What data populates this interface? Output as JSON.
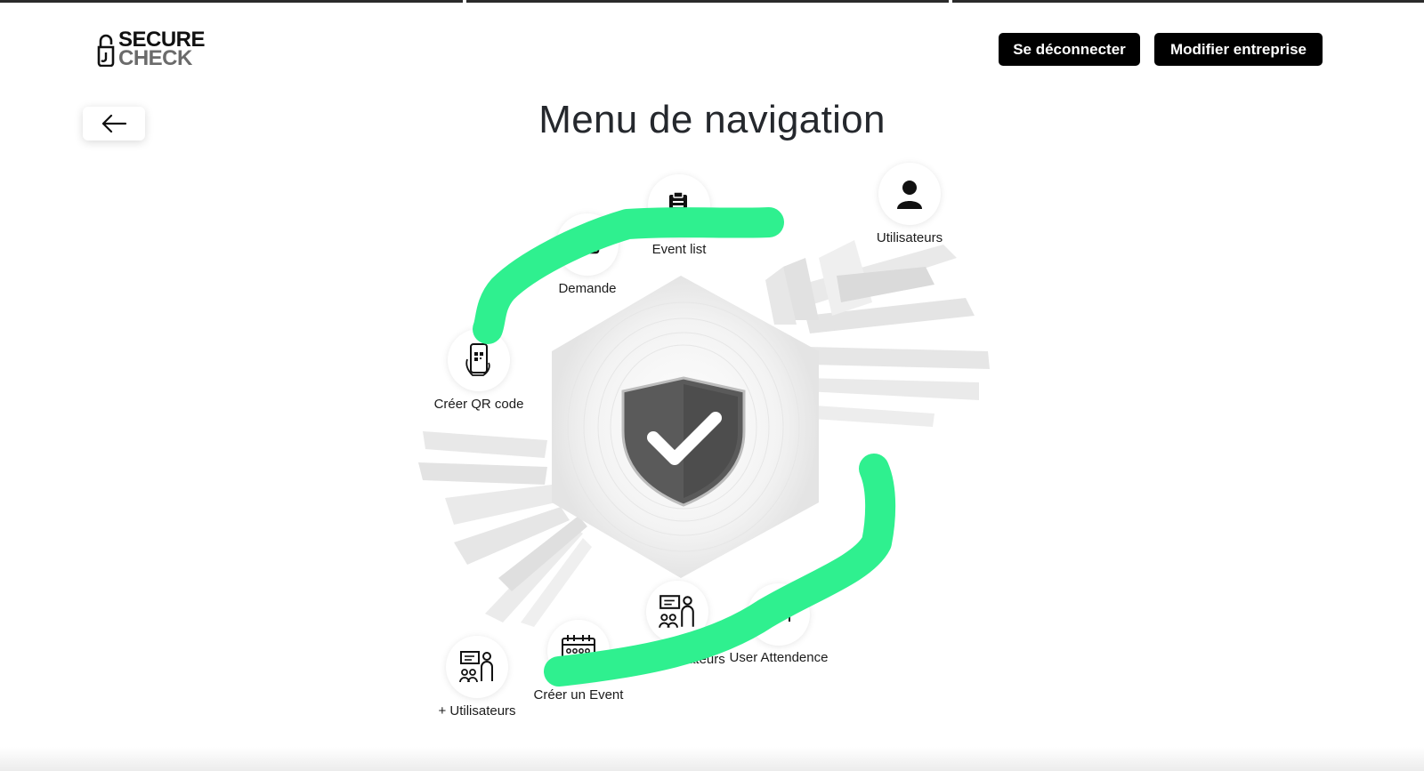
{
  "header": {
    "logo": {
      "line1": "SECURE",
      "line2": "CHECK"
    },
    "logout_label": "Se déconnecter",
    "edit_company_label": "Modifier entreprise"
  },
  "page_title": "Menu de navigation",
  "nav": {
    "event_list": "Event list",
    "demande": "Demande",
    "utilisateurs": "Utilisateurs",
    "creer_qr": "Créer QR code",
    "plus_utilisateurs": "+ Utilisateurs",
    "creer_event": "Créer un Event",
    "liste_utilisateurs": "Liste utilisateurs",
    "user_attendence": "User Attendence"
  },
  "colors": {
    "annotation": "#2ff08f",
    "button_bg": "#000000",
    "title": "#25282d"
  },
  "icons": {
    "back": "arrow-left-icon",
    "center": "shield-check-icon",
    "event_list": "clipboard-check-icon",
    "demande": "inbox-icon",
    "utilisateurs": "user-icon",
    "creer_qr": "phone-qr-icon",
    "plus_utilisateurs": "presentation-group-icon",
    "creer_event": "calendar-icon",
    "liste_utilisateurs": "presentation-group-icon",
    "user_attendence": "attendance-icon"
  }
}
